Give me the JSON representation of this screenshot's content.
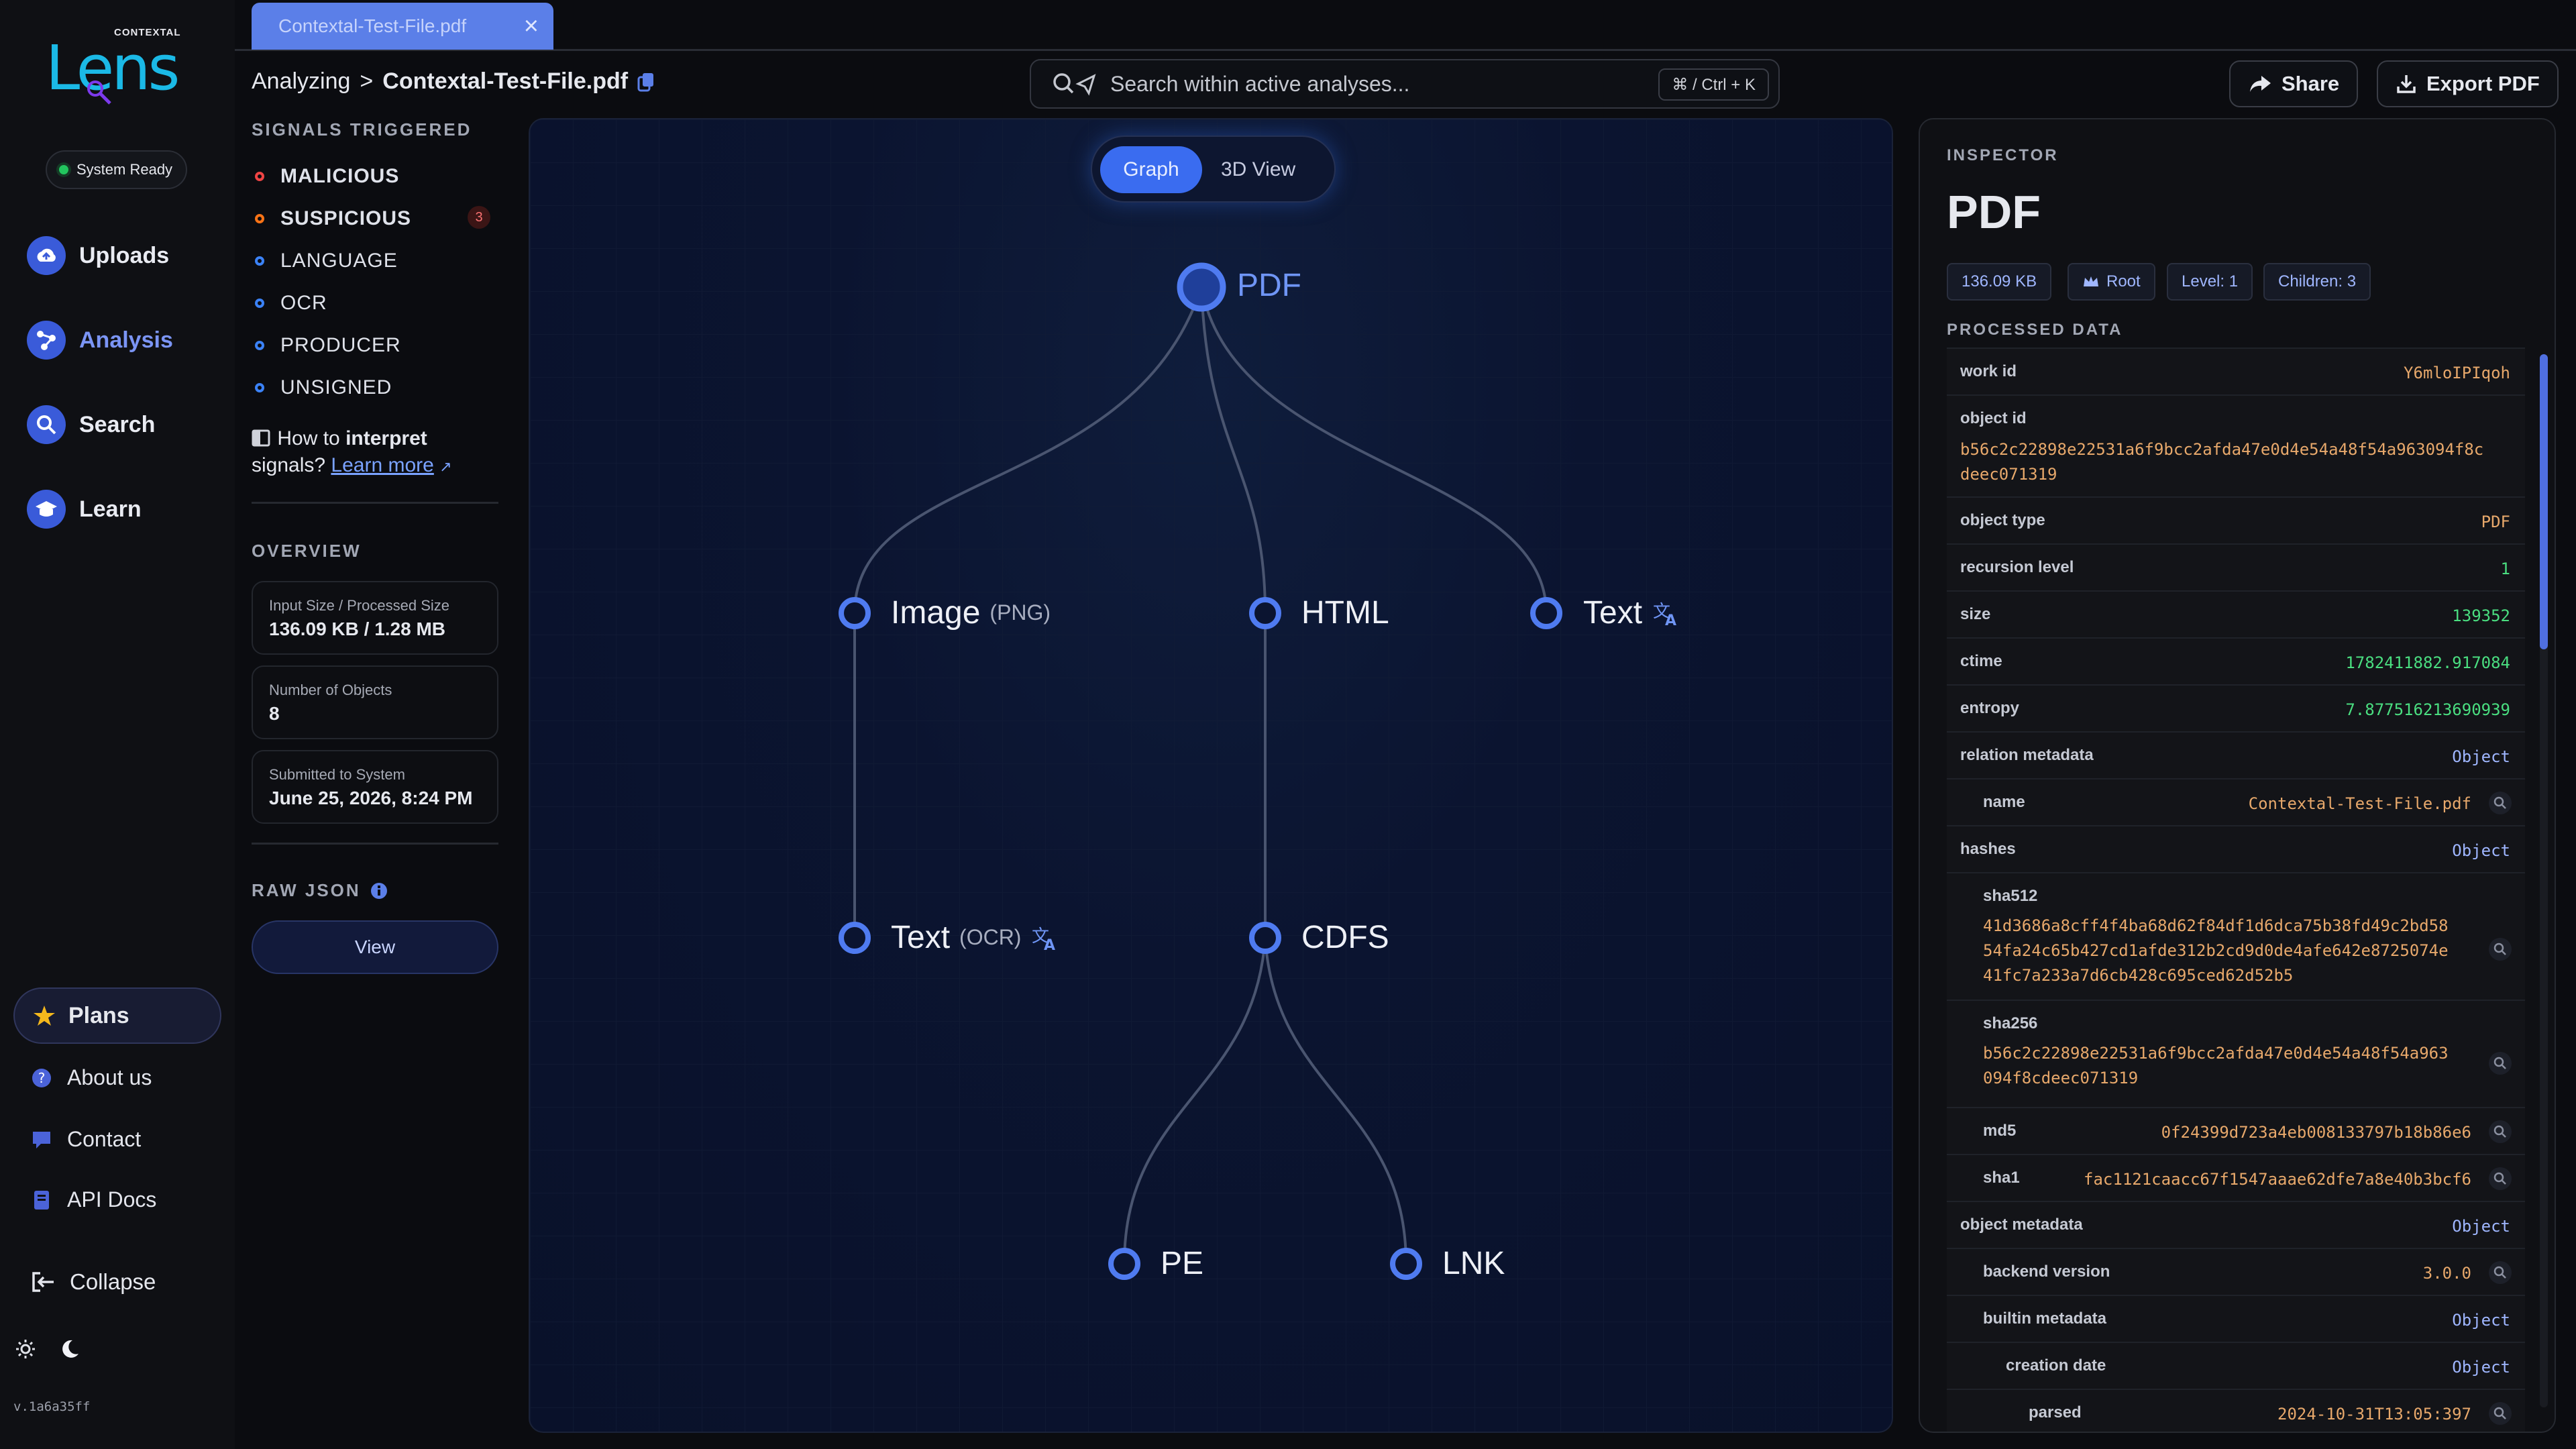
{
  "app": {
    "brand_small": "CONTEXTAL",
    "brand": "Lens",
    "status": "System Ready",
    "version": "v.1a6a35ff"
  },
  "nav": {
    "uploads": "Uploads",
    "analysis": "Analysis",
    "search": "Search",
    "learn": "Learn",
    "plans": "Plans",
    "about": "About us",
    "contact": "Contact",
    "api": "API Docs",
    "collapse": "Collapse"
  },
  "tab": {
    "label": "Contextal-Test-File.pdf",
    "close": "×"
  },
  "breadcrumb": {
    "parent": "Analyzing",
    "sep": ">",
    "current": "Contextal-Test-File.pdf"
  },
  "search": {
    "placeholder": "Search within active analyses...",
    "shortcut": "⌘ / Ctrl + K"
  },
  "header": {
    "share": "Share",
    "export": "Export PDF"
  },
  "signals": {
    "title": "SIGNALS TRIGGERED",
    "items": [
      {
        "label": "MALICIOUS",
        "color": "#ef4444"
      },
      {
        "label": "SUSPICIOUS",
        "color": "#f97316",
        "count": "3"
      },
      {
        "label": "LANGUAGE",
        "color": "#3b82f6"
      },
      {
        "label": "OCR",
        "color": "#3b82f6"
      },
      {
        "label": "PRODUCER",
        "color": "#3b82f6"
      },
      {
        "label": "UNSIGNED",
        "color": "#3b82f6"
      }
    ],
    "howto_prefix": "How to ",
    "howto_bold": "interpret",
    "howto_line2": "signals? ",
    "learn_more": "Learn more"
  },
  "overview": {
    "title": "OVERVIEW",
    "cards": [
      {
        "label": "Input Size / Processed Size",
        "value": "136.09 KB / 1.28 MB"
      },
      {
        "label": "Number of Objects",
        "value": "8"
      },
      {
        "label": "Submitted to System",
        "value": "June 25, 2026, 8:24 PM"
      }
    ]
  },
  "raw_json": {
    "title": "RAW JSON",
    "button": "View"
  },
  "graph": {
    "toggle_graph": "Graph",
    "toggle_3d": "3D View",
    "nodes": {
      "pdf": "PDF",
      "image": "Image",
      "image_sub": "(PNG)",
      "html": "HTML",
      "text": "Text",
      "text_ocr": "Text",
      "text_ocr_sub": "(OCR)",
      "cdfs": "CDFS",
      "pe": "PE",
      "lnk": "LNK"
    }
  },
  "inspector": {
    "section": "INSPECTOR",
    "title": "PDF",
    "chips": [
      "136.09 KB",
      "Root",
      "Level: 1",
      "Children: 3"
    ],
    "processed": "PROCESSED DATA",
    "rows": {
      "work_id": {
        "k": "work id",
        "v": "Y6mloIPIqoh"
      },
      "object_id": {
        "k": "object id",
        "v1": "b56c2c22898e22531a6f9bcc2afda47e0d4e54a48f54a963094f8c",
        "v2": "deec071319"
      },
      "object_type": {
        "k": "object type",
        "v": "PDF"
      },
      "recursion": {
        "k": "recursion level",
        "v": "1"
      },
      "size": {
        "k": "size",
        "v": "139352"
      },
      "ctime": {
        "k": "ctime",
        "v": "1782411882.917084"
      },
      "entropy": {
        "k": "entropy",
        "v": "7.877516213690939"
      },
      "relation": {
        "k": "relation metadata",
        "v": "Object"
      },
      "name": {
        "k": "name",
        "v": "Contextal-Test-File.pdf"
      },
      "hashes": {
        "k": "hashes",
        "v": "Object"
      },
      "sha512": {
        "k": "sha512",
        "v1": "41d3686a8cff4f4ba68d62f84df1d6dca75b38fd49c2bd58",
        "v2": "54fa24c65b427cd1afde312b2cd9d0de4afe642e8725074e",
        "v3": "41fc7a233a7d6cb428c695ced62d52b5"
      },
      "sha256": {
        "k": "sha256",
        "v1": "b56c2c22898e22531a6f9bcc2afda47e0d4e54a48f54a963",
        "v2": "094f8cdeec071319"
      },
      "md5": {
        "k": "md5",
        "v": "0f24399d723a4eb008133797b18b86e6"
      },
      "sha1": {
        "k": "sha1",
        "v": "fac1121caacc67f1547aaae62dfe7a8e40b3bcf6"
      },
      "object_meta": {
        "k": "object metadata",
        "v": "Object"
      },
      "backend": {
        "k": "backend version",
        "v": "3.0.0"
      },
      "builtin": {
        "k": "builtin metadata",
        "v": "Object"
      },
      "creation": {
        "k": "creation date",
        "v": "Object"
      },
      "parsed": {
        "k": "parsed",
        "v": "2024-10-31T13:05:397"
      }
    }
  }
}
